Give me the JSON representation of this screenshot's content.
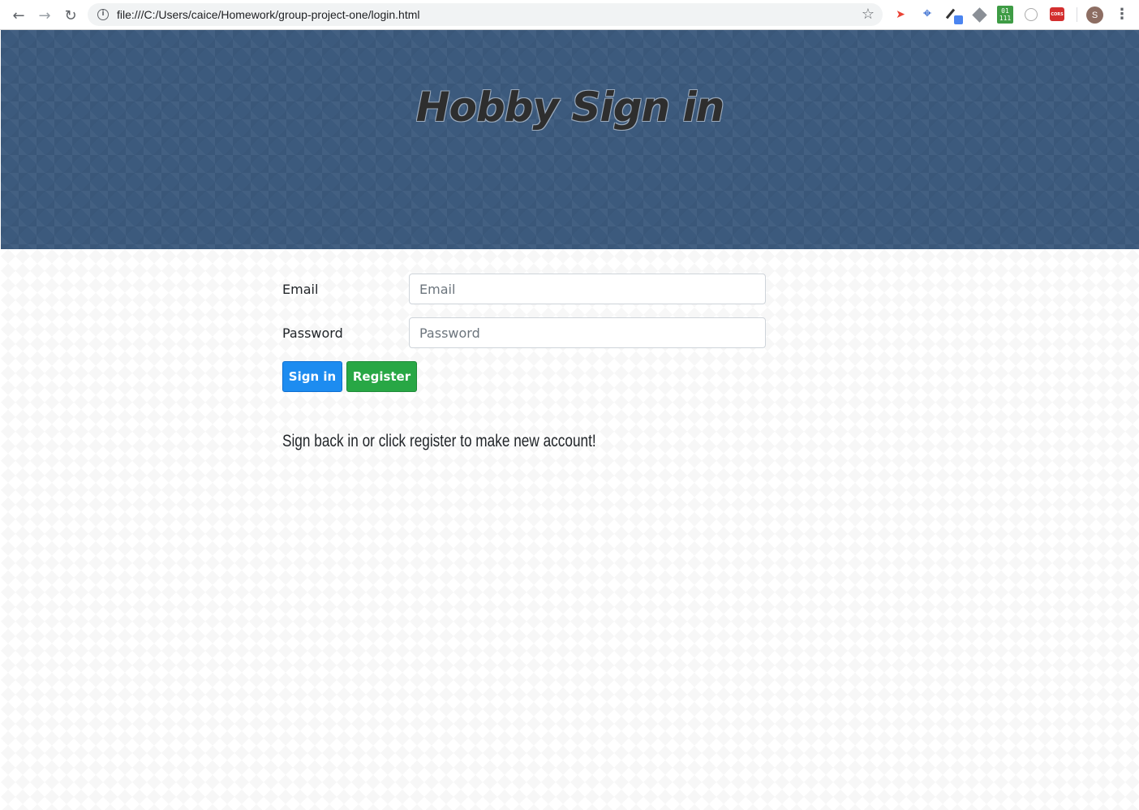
{
  "browser": {
    "url": "file:///C:/Users/caice/Homework/group-project-one/login.html",
    "profile_initial": "S",
    "extensions": [
      "red-arrow-icon",
      "crop-icon",
      "color-picker-icon",
      "diamond-icon",
      "binary-icon",
      "circle-icon",
      "cors-icon"
    ],
    "binary_ext_text_top": "01",
    "binary_ext_text_bottom": "111",
    "cors_ext_text": "CORS"
  },
  "header": {
    "title": "Hobby Sign in",
    "background_color": "#3c5a7d"
  },
  "form": {
    "email_label": "Email",
    "email_placeholder": "Email",
    "password_label": "Password",
    "password_placeholder": "Password",
    "signin_label": "Sign in",
    "register_label": "Register"
  },
  "helper_text": "Sign back in or click register to make new account!",
  "colors": {
    "signin_button": "#1d8cf0",
    "register_button": "#28a745"
  }
}
